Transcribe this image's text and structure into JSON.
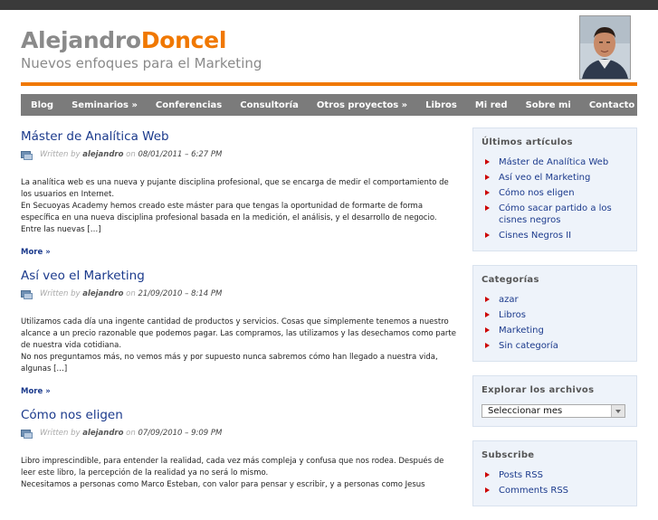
{
  "header": {
    "title_part1": "Alejandro",
    "title_part2": "Doncel",
    "tagline": "Nuevos enfoques para el Marketing"
  },
  "nav": {
    "items": [
      "Blog",
      "Seminarios »",
      "Conferencias",
      "Consultoría",
      "Otros proyectos »",
      "Libros",
      "Mi red",
      "Sobre mi",
      "Contacto"
    ]
  },
  "posts": [
    {
      "title": "Máster de Analítica Web",
      "written_by": "Written by",
      "author": "alejandro",
      "on": "on",
      "date": "08/01/2011 – 6:27 PM",
      "excerpt": [
        "La analítica web es una nueva y pujante disciplina profesional, que se encarga  de medir el comportamiento de los usuarios en Internet.",
        "En Secuoyas Academy hemos creado este máster para que tengas la oportunidad de formarte de forma específica en una nueva disciplina profesional basada en la medición, el análisis, y el desarrollo de negocio. Entre las nuevas […]"
      ],
      "more": "More »"
    },
    {
      "title": "Así veo el Marketing",
      "written_by": "Written by",
      "author": "alejandro",
      "on": "on",
      "date": "21/09/2010 – 8:14 PM",
      "excerpt": [
        "Utilizamos cada día una ingente cantidad de productos y servicios.  Cosas que simplemente tenemos a nuestro alcance a un precio razonable que podemos pagar. Las compramos, las utilizamos y las desechamos como parte de nuestra vida cotidiana.",
        "No nos preguntamos más, no vemos más y por supuesto nunca sabremos cómo han llegado a nuestra vida, algunas […]"
      ],
      "more": "More »"
    },
    {
      "title": "Cómo nos eligen",
      "written_by": "Written by",
      "author": "alejandro",
      "on": "on",
      "date": "07/09/2010 – 9:09 PM",
      "excerpt": [
        "Libro imprescindible, para entender la realidad, cada vez más compleja y confusa que nos rodea. Después de leer este libro, la percepción de la realidad ya no será lo mismo.",
        "Necesitamos  a personas como Marco Esteban, con valor para pensar y escribir, y a personas como Jesus"
      ],
      "more": ""
    }
  ],
  "sidebar": {
    "recent": {
      "title": "Últimos artículos",
      "items": [
        "Máster de Analítica Web",
        "Así veo el Marketing",
        "Cómo nos eligen",
        "Cómo sacar partido a los cisnes negros",
        "Cisnes Negros II"
      ]
    },
    "categories": {
      "title": "Categorías",
      "items": [
        "azar",
        "Libros",
        "Marketing",
        "Sin categoría"
      ]
    },
    "archives": {
      "title": "Explorar los archivos",
      "select_value": "Seleccionar mes"
    },
    "subscribe": {
      "title": "Subscribe",
      "items": [
        "Posts RSS",
        "Comments RSS"
      ]
    }
  }
}
